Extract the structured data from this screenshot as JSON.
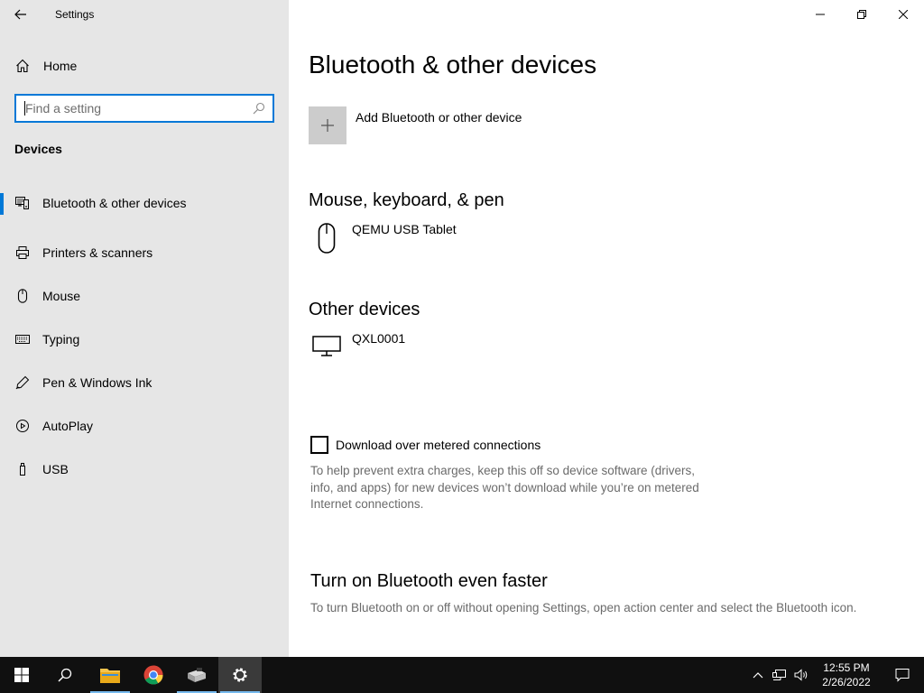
{
  "window": {
    "title": "Settings"
  },
  "sidebar": {
    "home_label": "Home",
    "search_placeholder": "Find a setting",
    "section_title": "Devices",
    "items": [
      {
        "label": "Bluetooth & other devices",
        "icon": "bluetooth-devices-icon",
        "active": true
      },
      {
        "label": "Printers & scanners",
        "icon": "printer-icon",
        "active": false
      },
      {
        "label": "Mouse",
        "icon": "mouse-icon",
        "active": false
      },
      {
        "label": "Typing",
        "icon": "keyboard-icon",
        "active": false
      },
      {
        "label": "Pen & Windows Ink",
        "icon": "pen-icon",
        "active": false
      },
      {
        "label": "AutoPlay",
        "icon": "autoplay-icon",
        "active": false
      },
      {
        "label": "USB",
        "icon": "usb-icon",
        "active": false
      }
    ]
  },
  "main": {
    "title": "Bluetooth & other devices",
    "add_device_label": "Add Bluetooth or other device",
    "groups": [
      {
        "title": "Mouse, keyboard, & pen",
        "devices": [
          {
            "name": "QEMU USB Tablet",
            "icon": "mouse-icon"
          }
        ]
      },
      {
        "title": "Other devices",
        "devices": [
          {
            "name": "QXL0001",
            "icon": "monitor-icon"
          }
        ]
      }
    ],
    "metered": {
      "label": "Download over metered connections",
      "checked": false,
      "help": "To help prevent extra charges, keep this off so device software (drivers, info, and apps) for new devices won’t download while you’re on metered Internet connections."
    },
    "bt_faster": {
      "title": "Turn on Bluetooth even faster",
      "text": "To turn Bluetooth on or off without opening Settings, open action center and select the Bluetooth icon."
    }
  },
  "taskbar": {
    "time": "12:55 PM",
    "date": "2/26/2022"
  },
  "colors": {
    "accent": "#0078d7",
    "sidebar_bg": "#e6e6e6",
    "taskbar_bg": "#101010"
  }
}
